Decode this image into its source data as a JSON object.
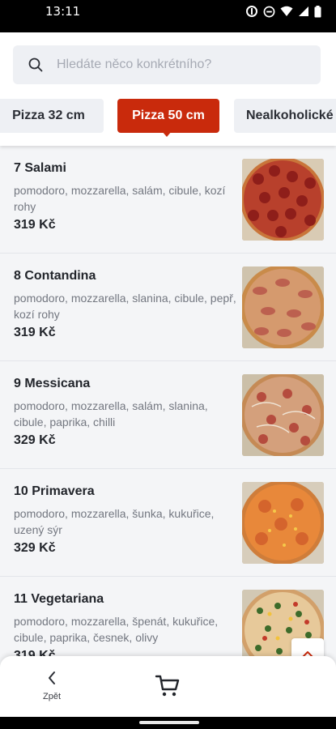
{
  "status": {
    "time": "13:11"
  },
  "search": {
    "placeholder": "Hledáte něco konkrétního?"
  },
  "tabs": [
    {
      "label": "Pizza 32 cm",
      "active": false
    },
    {
      "label": "Pizza 50 cm",
      "active": true
    },
    {
      "label": "Nealkoholické",
      "active": false
    }
  ],
  "items": [
    {
      "name": "7 Salami",
      "desc": "pomodoro, mozzarella, salám, cibule, kozí rohy",
      "price": "319 Kč"
    },
    {
      "name": "8 Contandina",
      "desc": "pomodoro, mozzarella, slanina, cibule, pepř, kozí rohy",
      "price": "319 Kč"
    },
    {
      "name": "9 Messicana",
      "desc": "pomodoro, mozzarella, salám, slanina, cibule, paprika, chilli",
      "price": "329 Kč"
    },
    {
      "name": "10 Primavera",
      "desc": "pomodoro, mozzarella, šunka, kukuřice, uzený sýr",
      "price": "329 Kč"
    },
    {
      "name": "11 Vegetariana",
      "desc": "pomodoro, mozzarella, špenát, kukuřice, cibule, paprika, česnek, olivy",
      "price": "319 Kč"
    }
  ],
  "bottom": {
    "back_label": "Zpět"
  },
  "colors": {
    "accent": "#c92a0c",
    "background": "#f4f5f7",
    "search_bg": "#eef0f4"
  },
  "icons": [
    "search-icon",
    "chevron-up-icon",
    "chevron-left-icon",
    "cart-icon",
    "wifi-icon",
    "battery-icon",
    "signal-icon"
  ]
}
